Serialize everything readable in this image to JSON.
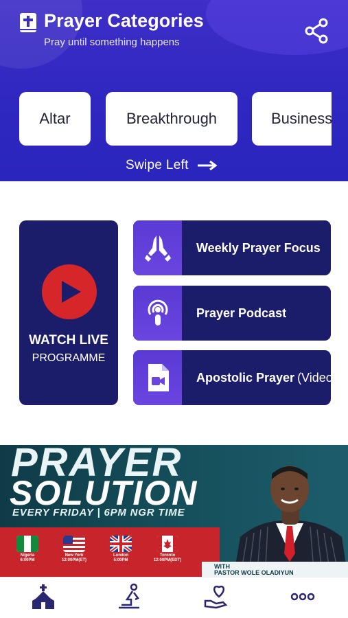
{
  "header": {
    "title": "Prayer Categories",
    "subtitle": "Pray until something happens",
    "share_icon": "share-icon",
    "app_icon": "bible-icon"
  },
  "categories": [
    {
      "label": "Altar"
    },
    {
      "label": "Breakthrough"
    },
    {
      "label": "Business"
    }
  ],
  "swipe_hint": "Swipe Left",
  "live": {
    "title": "WATCH LIVE",
    "subtitle": "PROGRAMME",
    "icon": "play-icon"
  },
  "features": [
    {
      "label": "Weekly Prayer Focus",
      "suffix": "",
      "icon": "praying-hands-icon"
    },
    {
      "label": "Prayer Podcast",
      "suffix": "",
      "icon": "podcast-icon"
    },
    {
      "label": "Apostolic Prayer",
      "suffix": "(Video)",
      "icon": "video-file-icon"
    }
  ],
  "banner": {
    "title_line1": "PRAYER",
    "title_line2": "SOLUTION",
    "schedule": "EVERY FRIDAY | 6PM NGR TIME",
    "times": [
      {
        "city": "Nigeria",
        "time": "6:00PM"
      },
      {
        "city": "New York",
        "time": "12:00PM(ET)"
      },
      {
        "city": "London",
        "time": "5:00PM"
      },
      {
        "city": "Toronto",
        "time": "12:00PM(EDT)"
      }
    ],
    "with_line1": "WITH",
    "with_line2": "PASTOR WOLE OLADIYUN"
  },
  "bottom_nav": [
    {
      "icon": "church-icon"
    },
    {
      "icon": "kneeling-prayer-icon"
    },
    {
      "icon": "heart-hand-icon"
    },
    {
      "icon": "more-icon"
    }
  ],
  "colors": {
    "header_bg": "#2f27c0",
    "card_bg": "#1c1d6a",
    "icon_box": "#5a3ad4",
    "play_red": "#d7262a",
    "banner_red": "#c7242b"
  }
}
